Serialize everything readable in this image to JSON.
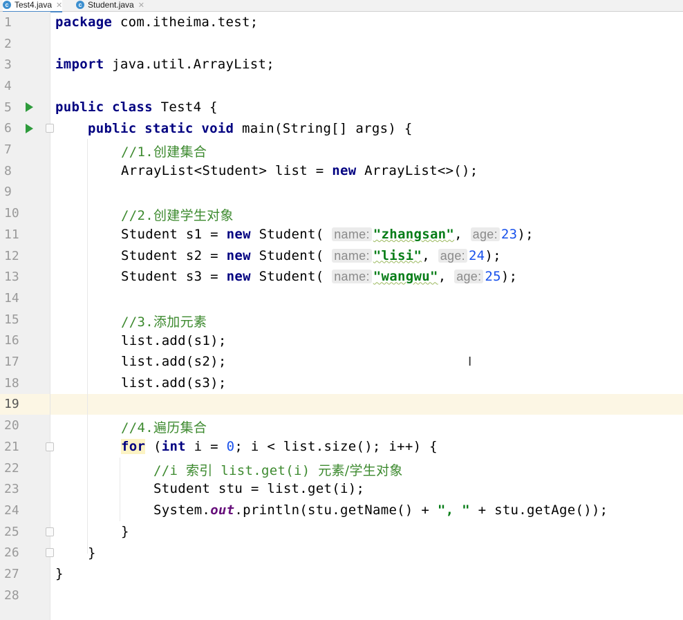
{
  "tabs": [
    {
      "label": "Test4.java",
      "icon": "class-icon",
      "active": true
    },
    {
      "label": "Student.java",
      "icon": "class-icon",
      "active": false
    }
  ],
  "editor": {
    "line_numbers": [
      "1",
      "2",
      "3",
      "4",
      "5",
      "6",
      "7",
      "8",
      "9",
      "10",
      "11",
      "12",
      "13",
      "14",
      "15",
      "16",
      "17",
      "18",
      "19",
      "20",
      "21",
      "22",
      "23",
      "24",
      "25",
      "26",
      "27",
      "28"
    ],
    "current_line": "19",
    "lines": {
      "l1": {
        "kw": "package",
        "rest": " com.itheima.test;"
      },
      "l3": {
        "kw": "import",
        "rest": " java.util.ArrayList;"
      },
      "l5": {
        "kw": "public class",
        "rest": " Test4 {"
      },
      "l6": {
        "kw": "public static void",
        "rest": " main(String[] args) {"
      },
      "l7": {
        "prefix": "//1.",
        "cjk": "创建集合"
      },
      "l8": {
        "pre": "ArrayList<Student> list = ",
        "kw": "new",
        "post": " ArrayList<>();"
      },
      "l10": {
        "prefix": "//2.",
        "cjk": "创建学生对象"
      },
      "l11": {
        "pre": "Student s1 = ",
        "kw": "new",
        "call": " Student(",
        "hint1": "name:",
        "str": "\"zhangsan\"",
        "comma": ",",
        "hint2": "age:",
        "num": "23",
        "post": ");"
      },
      "l12": {
        "pre": "Student s2 = ",
        "kw": "new",
        "call": " Student(",
        "hint1": "name:",
        "str": "\"lisi\"",
        "comma": ",",
        "hint2": "age:",
        "num": "24",
        "post": ");"
      },
      "l13": {
        "pre": "Student s3 = ",
        "kw": "new",
        "call": " Student(",
        "hint1": "name:",
        "str": "\"wangwu\"",
        "comma": ",",
        "hint2": "age:",
        "num": "25",
        "post": ");"
      },
      "l15": {
        "prefix": "//3.",
        "cjk": "添加元素"
      },
      "l16": {
        "text": "list.add(s1);"
      },
      "l17": {
        "text": "list.add(s2);"
      },
      "l18": {
        "text": "list.add(s3);"
      },
      "l20": {
        "prefix": "//4.",
        "cjk": "遍历集合"
      },
      "l21": {
        "kw": "for",
        "mid1": " (",
        "kw2": "int",
        "mid2": " i = ",
        "num": "0",
        "post": "; i < list.size(); i++) {"
      },
      "l22": {
        "prefix": "//i ",
        "cjk1": "索引",
        "mid": " list.get(i) ",
        "cjk2": "元素/学生对象"
      },
      "l23": {
        "text": "Student stu = list.get(i);"
      },
      "l24": {
        "pre": "System.",
        "field": "out",
        "mid": ".println(stu.getName() + ",
        "str": "\", \"",
        "post": " + stu.getAge());"
      },
      "l25": {
        "text": "}"
      },
      "l26": {
        "text": "}"
      },
      "l27": {
        "text": "}"
      }
    }
  },
  "colors": {
    "keyword": "#000080",
    "comment": "#3d8a2f",
    "string": "#067d17",
    "number": "#1750eb",
    "static_field": "#660e7a",
    "current_line": "#fcf6e4",
    "run_icon": "#2e9b3c"
  }
}
